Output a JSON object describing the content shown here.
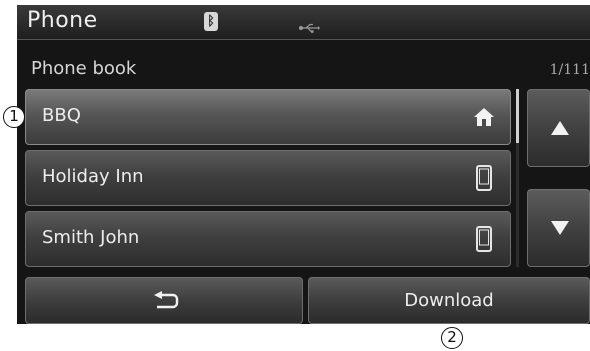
{
  "header": {
    "title": "Phone",
    "bluetooth_icon": "bluetooth-icon",
    "usb_icon": "usb-icon"
  },
  "subheader": {
    "title": "Phone book",
    "page_count": "1/111"
  },
  "contacts": [
    {
      "name": "BBQ",
      "icon": "home-icon",
      "selected": true
    },
    {
      "name": "Holiday Inn",
      "icon": "mobile-phone-icon",
      "selected": false
    },
    {
      "name": "Smith John",
      "icon": "mobile-phone-icon",
      "selected": false
    }
  ],
  "scroll": {
    "up_icon": "arrow-up-icon",
    "down_icon": "arrow-down-icon"
  },
  "footer": {
    "back_icon": "back-icon",
    "download_label": "Download"
  },
  "callouts": {
    "one": "1",
    "two": "2"
  },
  "colors": {
    "screen_background": "#151515",
    "button_gradient_top": "#5a5a5a",
    "button_gradient_bottom": "#2d2d2d",
    "text": "#ededed"
  }
}
